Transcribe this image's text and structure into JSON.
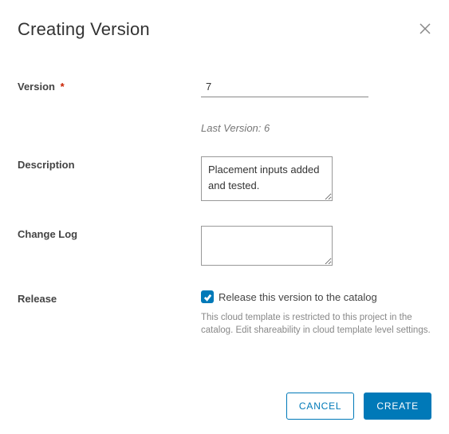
{
  "dialog": {
    "title": "Creating Version",
    "version_label": "Version",
    "version_value": "7",
    "last_version": "Last Version: 6",
    "description_label": "Description",
    "description_value": "Placement inputs added and tested.",
    "change_log_label": "Change Log",
    "change_log_value": "",
    "release_label": "Release",
    "release_checkbox_label": "Release this version to the catalog",
    "release_checked": true,
    "release_note": "This cloud template is restricted to this project in the catalog. Edit shareability in cloud template level settings.",
    "cancel_label": "CANCEL",
    "create_label": "CREATE"
  }
}
